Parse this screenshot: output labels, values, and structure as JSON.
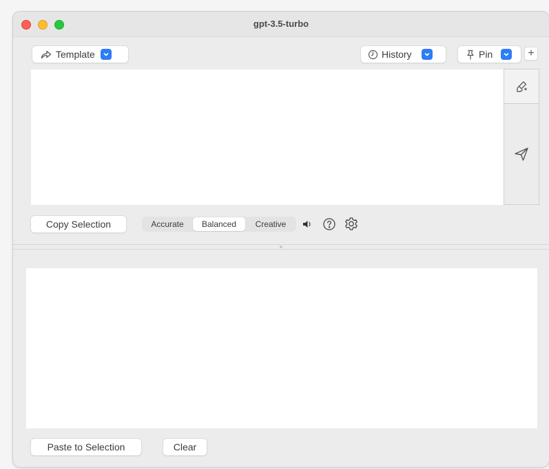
{
  "window": {
    "title": "gpt-3.5-turbo"
  },
  "toolbar": {
    "template_label": "Template",
    "history_label": "History",
    "pin_label": "Pin",
    "add_symbol": "+"
  },
  "prompt_editor": {
    "value": ""
  },
  "side_actions": {
    "top_icon": "broom-sparkle-icon",
    "send_icon": "paper-plane-icon"
  },
  "controls": {
    "copy_selection_label": "Copy Selection",
    "temperature_modes": [
      "Accurate",
      "Balanced",
      "Creative"
    ],
    "selected_mode": "Balanced",
    "speaker_icon": "speaker-icon",
    "help_icon": "question-circle-icon",
    "settings_icon": "gear-icon"
  },
  "output": {
    "value": ""
  },
  "footer": {
    "paste_label": "Paste to Selection",
    "clear_label": "Clear"
  },
  "colors": {
    "accent": "#2e7cf6",
    "close": "#fe5f57",
    "minimize": "#febc2e",
    "maximize": "#28c840"
  }
}
